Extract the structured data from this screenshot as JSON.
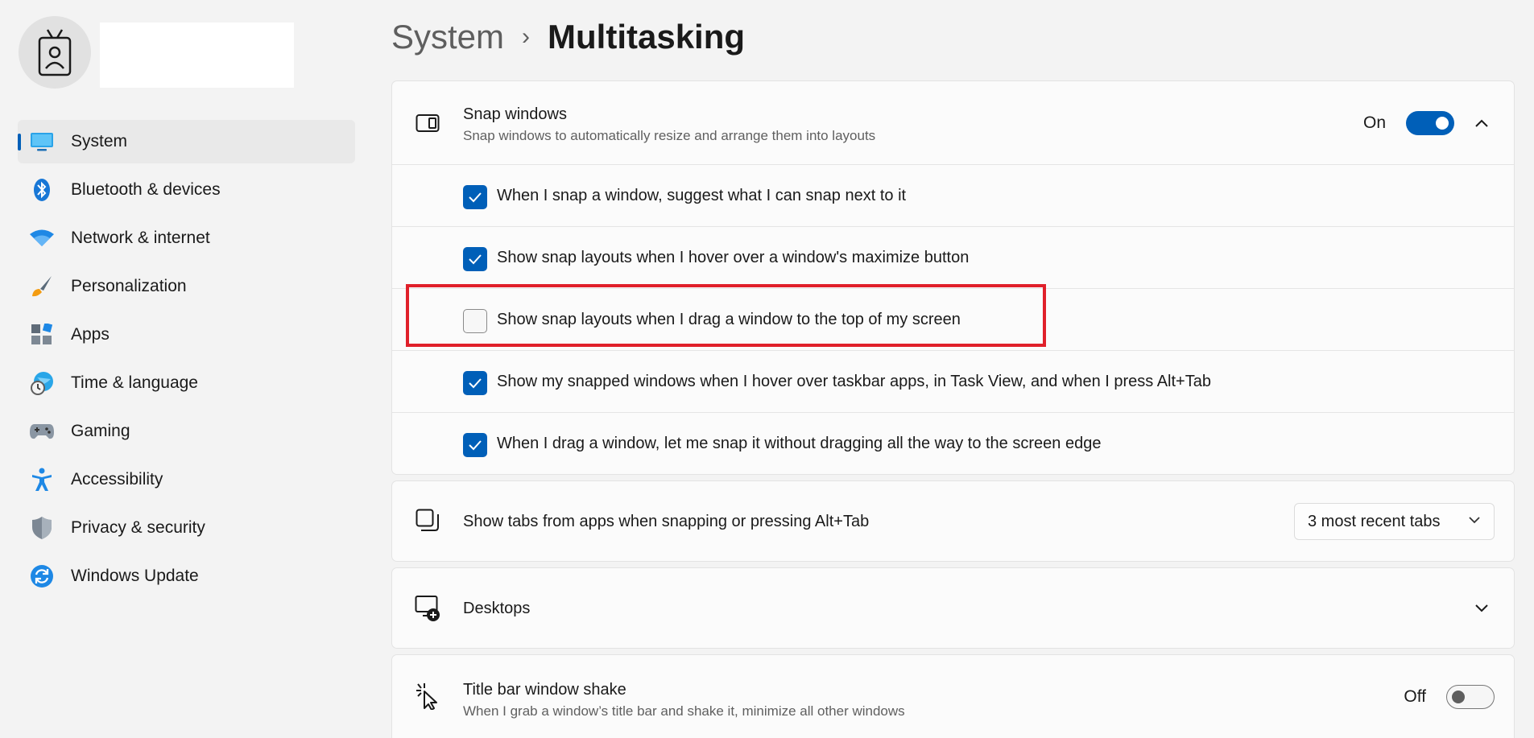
{
  "sidebar": {
    "items": [
      {
        "label": "System",
        "icon": "monitor-icon",
        "active": true
      },
      {
        "label": "Bluetooth & devices",
        "icon": "bluetooth-icon"
      },
      {
        "label": "Network & internet",
        "icon": "wifi-icon"
      },
      {
        "label": "Personalization",
        "icon": "brush-icon"
      },
      {
        "label": "Apps",
        "icon": "apps-icon"
      },
      {
        "label": "Time & language",
        "icon": "globe-clock-icon"
      },
      {
        "label": "Gaming",
        "icon": "gamepad-icon"
      },
      {
        "label": "Accessibility",
        "icon": "accessibility-icon"
      },
      {
        "label": "Privacy & security",
        "icon": "shield-icon"
      },
      {
        "label": "Windows Update",
        "icon": "update-icon"
      }
    ]
  },
  "header": {
    "parent": "System",
    "separator": "›",
    "current": "Multitasking"
  },
  "snap": {
    "title": "Snap windows",
    "subtitle": "Snap windows to automatically resize and arrange them into layouts",
    "state": "On",
    "options": [
      {
        "label": "When I snap a window, suggest what I can snap next to it",
        "checked": true
      },
      {
        "label": "Show snap layouts when I hover over a window's maximize button",
        "checked": true
      },
      {
        "label": "Show snap layouts when I drag a window to the top of my screen",
        "checked": false
      },
      {
        "label": "Show my snapped windows when I hover over taskbar apps, in Task View, and when I press Alt+Tab",
        "checked": true
      },
      {
        "label": "When I drag a window, let me snap it without dragging all the way to the screen edge",
        "checked": true
      }
    ]
  },
  "tabs": {
    "title": "Show tabs from apps when snapping or pressing Alt+Tab",
    "value": "3 most recent tabs"
  },
  "desktops": {
    "title": "Desktops"
  },
  "shake": {
    "title": "Title bar window shake",
    "subtitle": "When I grab a window’s title bar and shake it, minimize all other windows",
    "state": "Off"
  },
  "colors": {
    "accent": "#005fb8",
    "highlight": "#e0202a"
  }
}
